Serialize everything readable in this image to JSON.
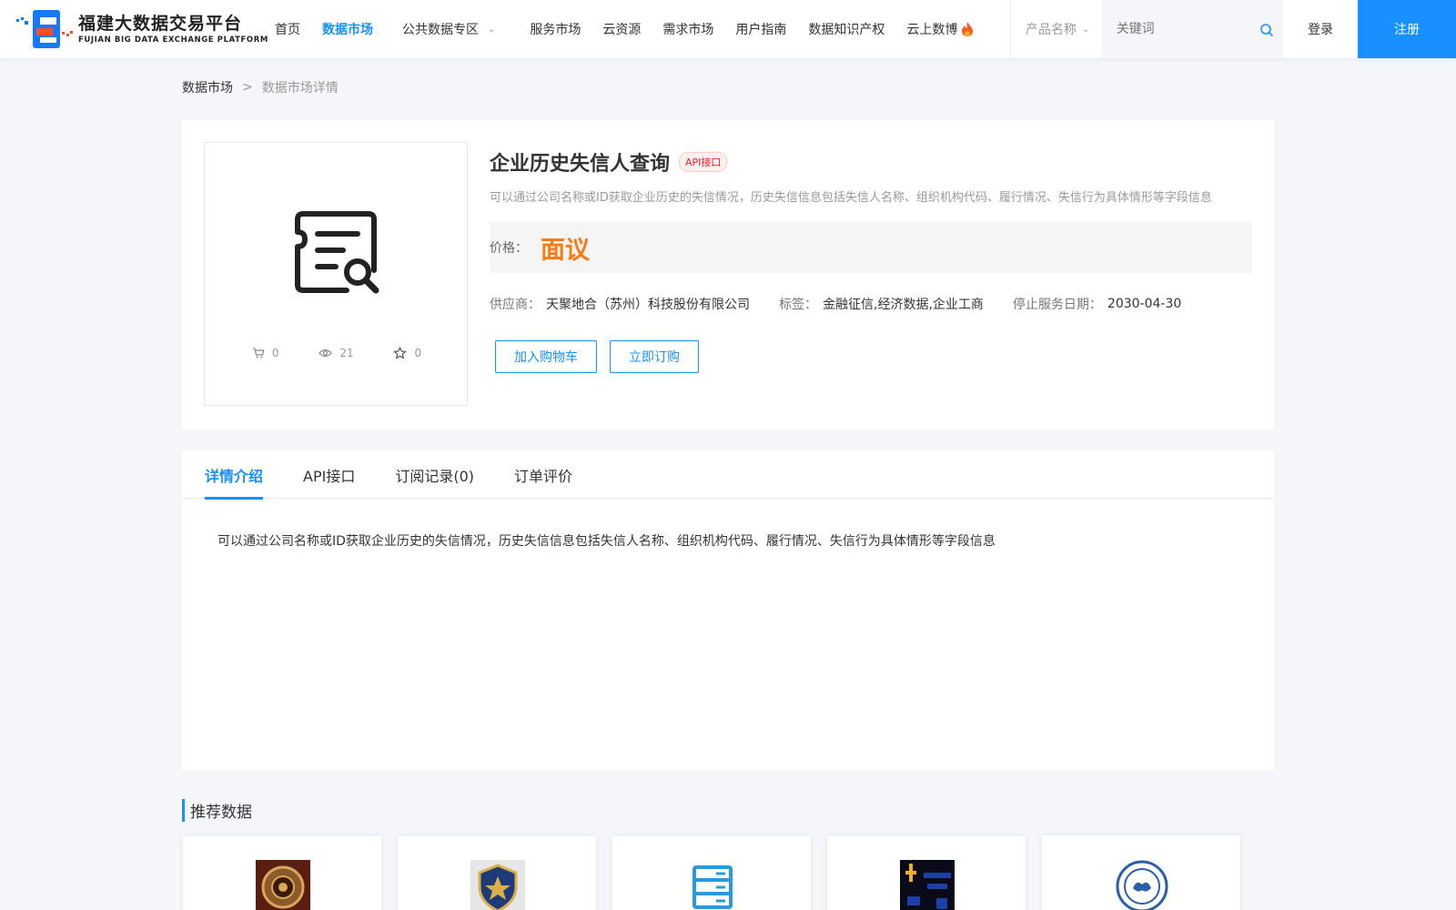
{
  "brand": {
    "name_cn": "福建大数据交易平台",
    "name_en": "FUJIAN BIG DATA EXCHANGE  PLATFORM"
  },
  "nav": {
    "items": [
      {
        "label": "首页"
      },
      {
        "label": "数据市场"
      },
      {
        "label": "公共数据专区"
      },
      {
        "label": "服务市场"
      },
      {
        "label": "云资源"
      },
      {
        "label": "需求市场"
      },
      {
        "label": "用户指南"
      },
      {
        "label": "数据知识产权"
      },
      {
        "label": "云上数博"
      }
    ],
    "active_index": 1
  },
  "search": {
    "category": "产品名称",
    "placeholder": "关键词"
  },
  "auth": {
    "login": "登录",
    "register": "注册"
  },
  "breadcrumb": {
    "level1": "数据市场",
    "separator": ">",
    "level2": "数据市场详情"
  },
  "product": {
    "title": "企业历史失信人查询",
    "badge": "API接口",
    "description": "可以通过公司名称或ID获取企业历史的失信情况，历史失信信息包括失信人名称、组织机构代码、履行情况、失信行为具体情形等字段信息",
    "price_label": "价格：",
    "price_value": "面议",
    "stats": {
      "cart": "0",
      "views": "21",
      "favorites": "0"
    },
    "supplier_label": "供应商：",
    "supplier": "天聚地合（苏州）科技股份有限公司",
    "tags_label": "标签：",
    "tags": "金融征信,经济数据,企业工商",
    "end_date_label": "停止服务日期：",
    "end_date": "2030-04-30",
    "add_cart": "加入购物车",
    "subscribe": "立即订购"
  },
  "tabs": [
    {
      "label": "详情介绍"
    },
    {
      "label": "API接口"
    },
    {
      "label": "订阅记录(0)"
    },
    {
      "label": "订单评价"
    }
  ],
  "detail": {
    "text": "可以通过公司名称或ID获取企业历史的失信情况，历史失信信息包括失信人名称、组织机构代码、履行情况、失信行为具体情形等字段信息"
  },
  "recommend": {
    "title": "推荐数据"
  },
  "colors": {
    "accent": "#1890ff",
    "price": "#fa7b15",
    "badge": "#f5222d"
  }
}
